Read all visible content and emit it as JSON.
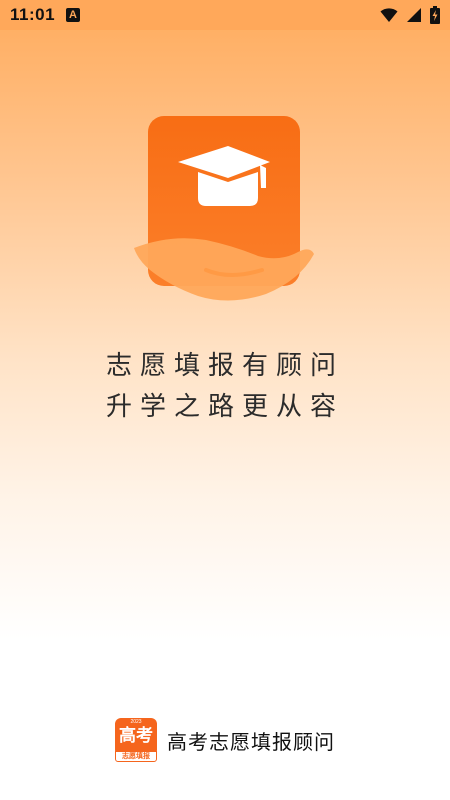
{
  "status_bar": {
    "time": "11:01",
    "notification_icon": "a-letter-icon",
    "notification_label": "A",
    "icons": [
      "wifi-icon",
      "cell-signal-icon",
      "battery-charging-icon"
    ]
  },
  "logo": {
    "icon": "graduation-cap-in-hand-icon",
    "colors": {
      "tile": "#f86d14",
      "hand": "#ffa85a",
      "cap": "#ffffff"
    }
  },
  "slogan": {
    "line1": "志愿填报有顾问",
    "line2": "升学之路更从容"
  },
  "footer": {
    "badge_title": "高考",
    "badge_year": "2023",
    "badge_subtitle": "志愿填报",
    "app_name": "高考志愿填报顾问"
  },
  "colors": {
    "accent": "#f5651d",
    "gradient_top": "#ffab5c",
    "background_bottom": "#ffffff"
  }
}
